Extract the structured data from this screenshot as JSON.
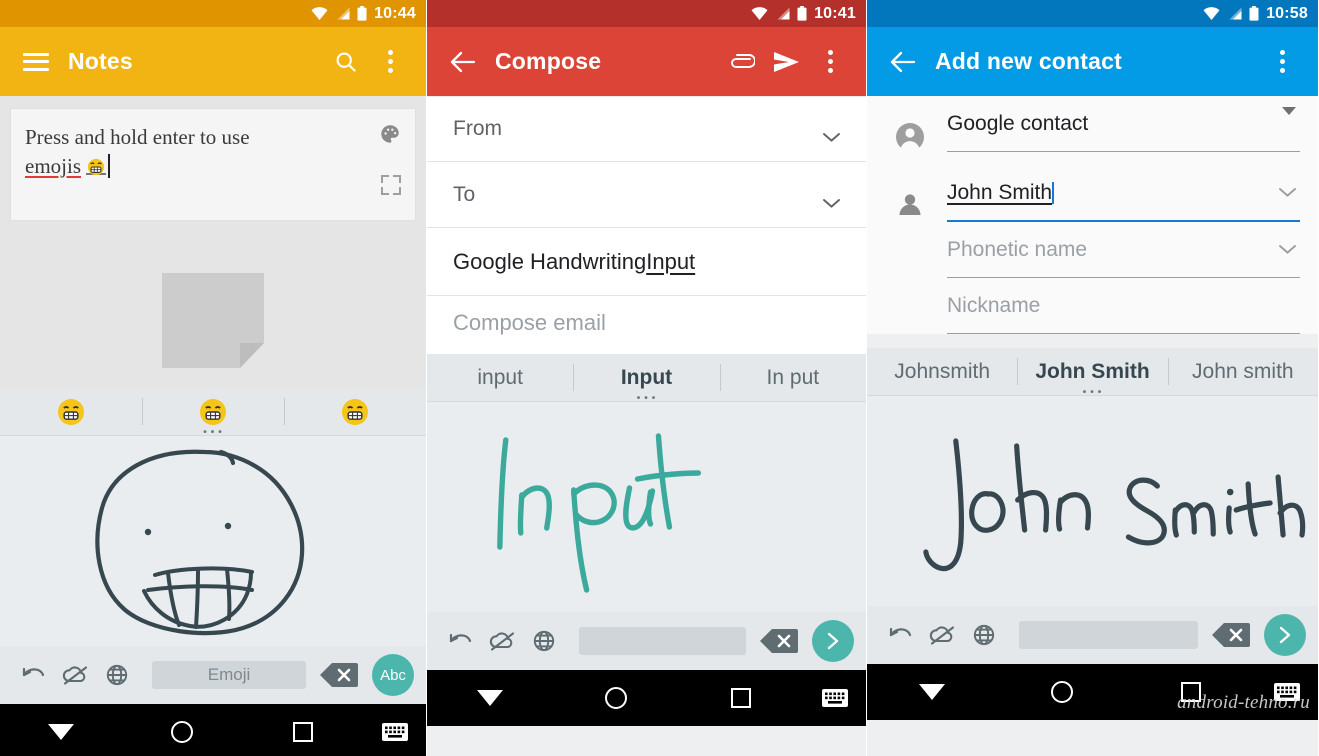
{
  "panels": [
    {
      "id": "notes",
      "status": {
        "time": "10:44",
        "icons": [
          "wifi-icon",
          "signal-icon",
          "battery-icon"
        ]
      },
      "appbar": {
        "title": "Notes",
        "nav_icon": "hamburger-menu-icon",
        "actions": [
          "search-icon",
          "overflow-menu-icon"
        ],
        "bar_color": "#F2B413",
        "status_color": "#E09400"
      },
      "note": {
        "line1": "Press and hold enter to use",
        "line2": "emojis",
        "emoji": "grinning-face",
        "palette_icon": "color-palette-icon",
        "expand_icon": "fullscreen-expand-icon",
        "placeholder_icon": "empty-note-page-icon"
      },
      "suggestions": [
        {
          "label": "grinning-face-emoji",
          "type": "emoji",
          "active": false
        },
        {
          "label": "grinning-face-emoji",
          "type": "emoji",
          "active": true
        },
        {
          "label": "grinning-face-emoji",
          "type": "emoji",
          "active": false
        }
      ],
      "canvas": {
        "drawing": "hand-drawn-grinning-face",
        "ink_color": "#37474F"
      },
      "keyboard": {
        "undo_icon": "undo-arrow-icon",
        "cloud_icon": "cloud-off-icon",
        "language_icon": "globe-language-icon",
        "space_label": "Emoji",
        "delete_icon": "backspace-delete-icon",
        "action_label": "Abc",
        "action_icon": "abc-keyboard-mode-icon",
        "action_color": "#4DB6AC"
      },
      "navbar": {
        "back": "back-triangle-icon",
        "home": "home-circle-icon",
        "recents": "recents-square-icon",
        "keyboard": "keyboard-icon"
      }
    },
    {
      "id": "compose",
      "status": {
        "time": "10:41",
        "icons": [
          "wifi-icon",
          "signal-icon",
          "battery-icon"
        ]
      },
      "appbar": {
        "title": "Compose",
        "nav_icon": "back-arrow-icon",
        "actions": [
          "attachment-paperclip-icon",
          "send-icon",
          "overflow-menu-icon"
        ],
        "bar_color": "#DB4437",
        "status_color": "#B3312A"
      },
      "fields": [
        {
          "label": "From",
          "chevron": "chevron-down-icon"
        },
        {
          "label": "To",
          "chevron": "chevron-down-icon"
        }
      ],
      "subject": {
        "text_plain": "Google Handwriting ",
        "text_underlined": "Input"
      },
      "body_placeholder": "Compose email",
      "suggestions": [
        {
          "label": "input",
          "active": false
        },
        {
          "label": "Input",
          "active": true
        },
        {
          "label": "In put",
          "active": false
        }
      ],
      "canvas": {
        "drawing": "handwritten-word-input",
        "ink_color": "#3BA99C"
      },
      "keyboard": {
        "undo_icon": "undo-arrow-icon",
        "cloud_icon": "cloud-off-icon",
        "language_icon": "globe-language-icon",
        "space_label": "",
        "delete_icon": "backspace-delete-icon",
        "action_label": "",
        "action_icon": "next-arrow-icon",
        "action_color": "#4DB6AC"
      },
      "navbar": {
        "back": "back-triangle-icon",
        "home": "home-circle-icon",
        "recents": "recents-square-icon",
        "keyboard": "keyboard-icon"
      }
    },
    {
      "id": "contact",
      "status": {
        "time": "10:58",
        "icons": [
          "wifi-icon",
          "signal-icon",
          "battery-icon"
        ]
      },
      "appbar": {
        "title": "Add new contact",
        "nav_icon": "back-arrow-icon",
        "actions": [
          "overflow-menu-icon"
        ],
        "bar_color": "#039BE5",
        "status_color": "#0277BD"
      },
      "account": {
        "icon": "account-circle-icon",
        "value": "Google contact",
        "dropdown": "dropdown-triangle-icon"
      },
      "name_fields": {
        "icon": "person-icon",
        "items": [
          {
            "value": "John Smith",
            "placeholder": "",
            "focused": true,
            "chevron": "chevron-down-icon",
            "spellcheck": true
          },
          {
            "value": "",
            "placeholder": "Phonetic name",
            "focused": false,
            "chevron": "chevron-down-icon",
            "spellcheck": false
          },
          {
            "value": "",
            "placeholder": "Nickname",
            "focused": false,
            "chevron": "",
            "spellcheck": false
          }
        ]
      },
      "suggestions": [
        {
          "label": "Johnsmith",
          "active": false
        },
        {
          "label": "John Smith",
          "active": true
        },
        {
          "label": "John smith",
          "active": false
        }
      ],
      "canvas": {
        "drawing": "handwritten-name-john-smith",
        "ink_color": "#37474F"
      },
      "keyboard": {
        "undo_icon": "undo-arrow-icon",
        "cloud_icon": "cloud-off-icon",
        "language_icon": "globe-language-icon",
        "space_label": "",
        "delete_icon": "backspace-delete-icon",
        "action_label": "",
        "action_icon": "next-arrow-icon",
        "action_color": "#4DB6AC"
      },
      "navbar": {
        "back": "back-triangle-icon",
        "home": "home-circle-icon",
        "recents": "recents-square-icon",
        "keyboard": "keyboard-icon"
      },
      "watermark": "android-tehno.ru"
    }
  ]
}
